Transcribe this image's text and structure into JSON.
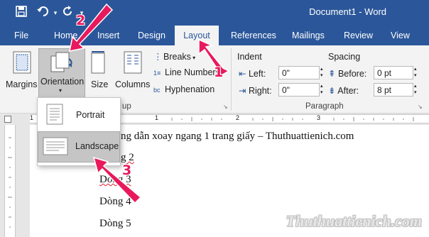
{
  "window": {
    "title": "Document1  -  Word"
  },
  "qat": {
    "save_icon": "save-icon",
    "undo_icon": "undo-icon",
    "redo_icon": "redo-icon"
  },
  "tabs": [
    {
      "label": "File"
    },
    {
      "label": "Home"
    },
    {
      "label": "Insert"
    },
    {
      "label": "Design"
    },
    {
      "label": "Layout",
      "active": true
    },
    {
      "label": "References"
    },
    {
      "label": "Mailings"
    },
    {
      "label": "Review"
    },
    {
      "label": "View"
    }
  ],
  "ribbon": {
    "margins_label": "Margins",
    "orientation_label": "Orientation",
    "size_label": "Size",
    "columns_label": "Columns",
    "breaks_label": "Breaks",
    "line_numbers_label": "Line Numbers",
    "hyphenation_label": "Hyphenation",
    "page_setup_group_partial": "up",
    "indent_header": "Indent",
    "indent_left_label": "Left:",
    "indent_left_value": "0\"",
    "indent_right_label": "Right:",
    "indent_right_value": "0\"",
    "spacing_header": "Spacing",
    "spacing_before_label": "Before:",
    "spacing_before_value": "0 pt",
    "spacing_after_label": "After:",
    "spacing_after_value": "8 pt",
    "paragraph_group_label": "Paragraph"
  },
  "ruler": {
    "num1": "1",
    "num2": "1",
    "num3": "2",
    "num4": "3"
  },
  "orientation_menu": {
    "items": [
      {
        "label": "Portrait",
        "selected": false
      },
      {
        "label": "Landscape",
        "selected": true
      }
    ]
  },
  "document": {
    "lines": [
      "ng dẫn xoay ngang 1 trang giấy – Thuthuattienich.com",
      "g 2",
      "Dòng 3",
      "Dòng 4",
      "Dòng 5"
    ]
  },
  "annotations": {
    "step1": "1",
    "step2": "2",
    "step3": "3",
    "arrow_color": "#e8195c"
  },
  "watermark": "Thuthuattienich.com",
  "colors": {
    "word_blue": "#2b579a",
    "ribbon_bg": "#f3f3f3"
  }
}
